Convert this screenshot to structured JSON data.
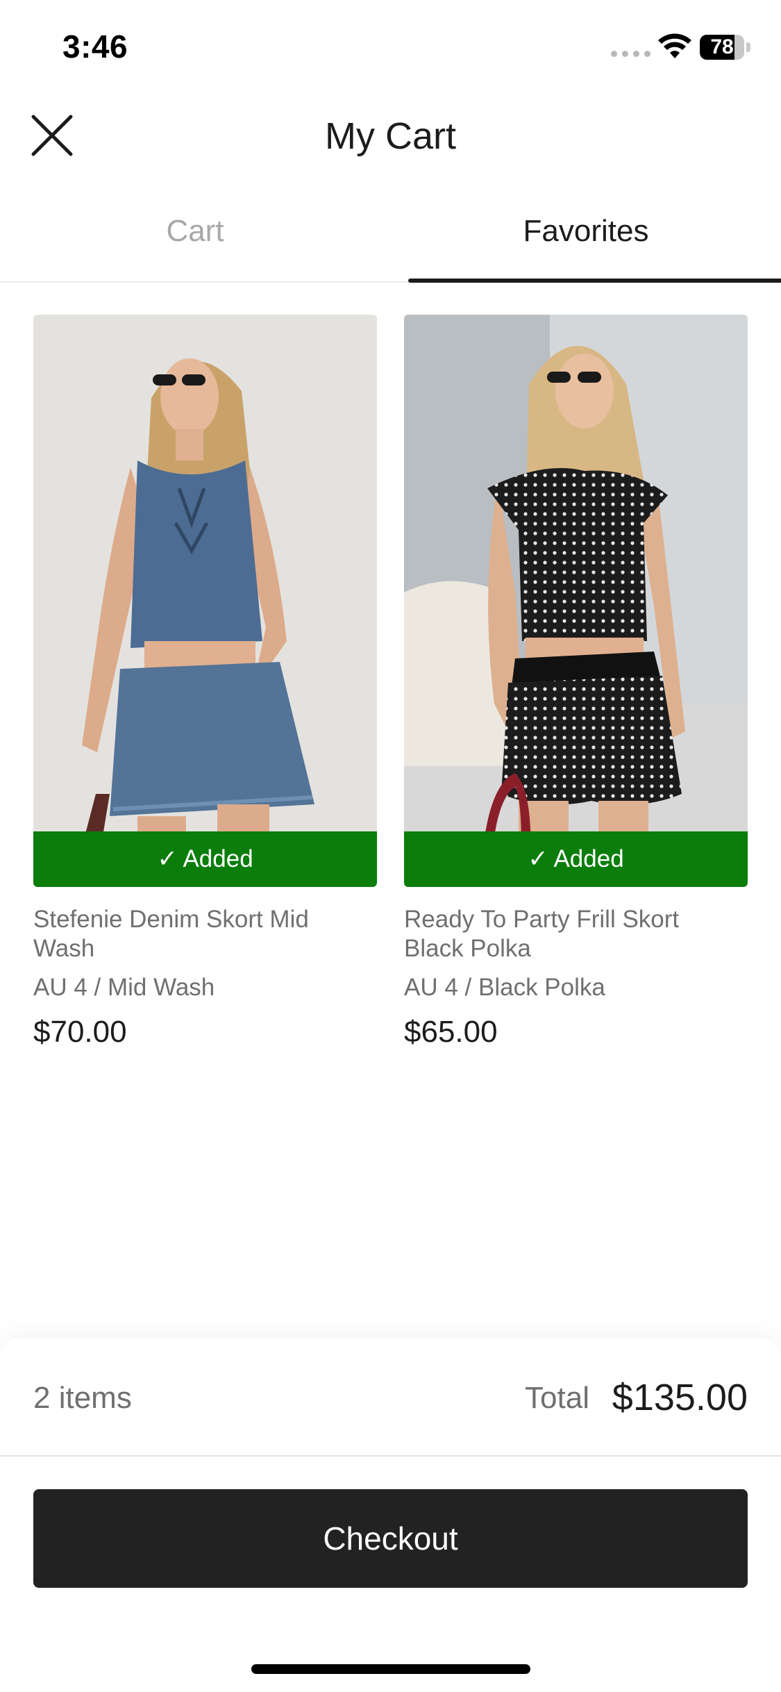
{
  "status_bar": {
    "time": "3:46",
    "battery_level": "78",
    "battery_fraction": 0.78,
    "icons": [
      "signal-dots-icon",
      "wifi-icon",
      "battery-icon"
    ]
  },
  "header": {
    "close_icon": "close-icon",
    "title": "My Cart"
  },
  "tabs": [
    {
      "label": "Cart",
      "active": false
    },
    {
      "label": "Favorites",
      "active": true
    }
  ],
  "products": [
    {
      "image": "denim-top-and-skort-photo",
      "added_label": "✓ Added",
      "name": "Stefenie Denim Skort Mid Wash",
      "variant": "AU 4 / Mid Wash",
      "price": "$70.00"
    },
    {
      "image": "polka-dot-top-and-skort-photo",
      "added_label": "✓ Added",
      "name": "Ready To Party Frill Skort Black Polka",
      "variant": "AU 4 / Black Polka",
      "price": "$65.00"
    }
  ],
  "summary": {
    "item_count": "2 items",
    "total_label": "Total",
    "total_value": "$135.00",
    "checkout_label": "Checkout"
  },
  "colors": {
    "added_green": "#0b7d0b",
    "checkout_dark": "#222222",
    "muted_text": "#6f6f6f",
    "inactive_tab": "#a8a8a8"
  }
}
